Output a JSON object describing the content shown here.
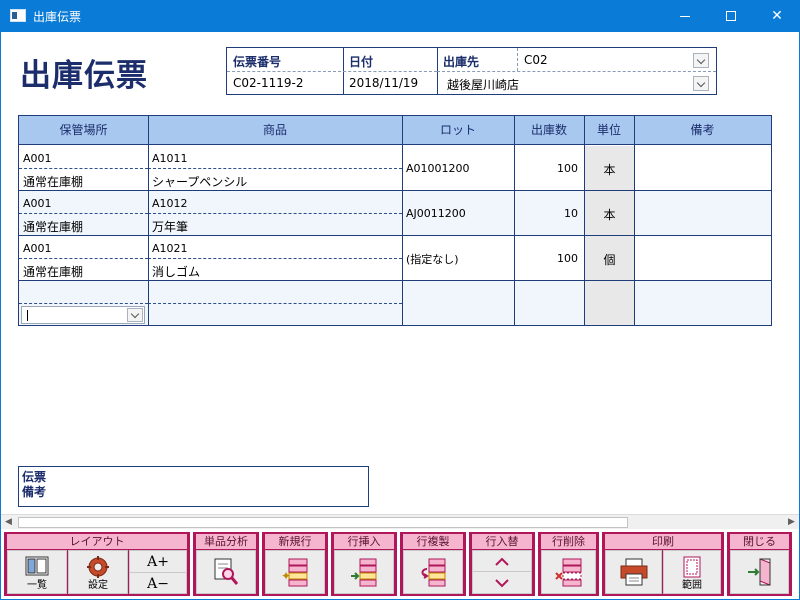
{
  "window": {
    "title": "出庫伝票",
    "minimize": "minimize",
    "maximize": "maximize",
    "close": "✕"
  },
  "doc_title": "出庫伝票",
  "header": {
    "slip_no_label": "伝票番号",
    "slip_no": "C02-1119-2",
    "date_label": "日付",
    "date": "2018/11/19",
    "dest_label": "出庫先",
    "dest_code": "C02",
    "dest_name": "越後屋川崎店"
  },
  "grid": {
    "columns": [
      "保管場所",
      "商品",
      "ロット",
      "出庫数",
      "単位",
      "備考"
    ],
    "rows": [
      {
        "loc_code": "A001",
        "loc_name": "通常在庫棚",
        "item_code": "A1011",
        "item_name": "シャープペンシル",
        "lot": "A01001200",
        "qty": "100",
        "unit": "本",
        "note": ""
      },
      {
        "loc_code": "A001",
        "loc_name": "通常在庫棚",
        "item_code": "A1012",
        "item_name": "万年筆",
        "lot": "AJ0011200",
        "qty": "10",
        "unit": "本",
        "note": ""
      },
      {
        "loc_code": "A001",
        "loc_name": "通常在庫棚",
        "item_code": "A1021",
        "item_name": "消しゴム",
        "lot": "(指定なし)",
        "qty": "100",
        "unit": "個",
        "note": ""
      }
    ]
  },
  "remark_label": "伝票 備考",
  "scroll": {
    "left": "◀",
    "right": "▶"
  },
  "toolbar": {
    "layout": {
      "title": "レイアウト",
      "list": "一覧",
      "settings": "設定",
      "font_up": "A+",
      "font_down": "A−"
    },
    "analysis": {
      "title": "単品分析"
    },
    "new_row": {
      "title": "新規行"
    },
    "insert_row": {
      "title": "行挿入"
    },
    "copy_row": {
      "title": "行複製"
    },
    "swap_row": {
      "title": "行入替"
    },
    "delete_row": {
      "title": "行削除"
    },
    "print": {
      "title": "印刷",
      "range": "範囲"
    },
    "close": {
      "title": "閉じる"
    }
  },
  "colors": {
    "titlebar": "#0a7bd6",
    "grid_header": "#a8c8f0",
    "toolbar_group": "#b0175a",
    "toolbar_title": "#f6b5cf",
    "doc_title": "#1b2d6b"
  }
}
